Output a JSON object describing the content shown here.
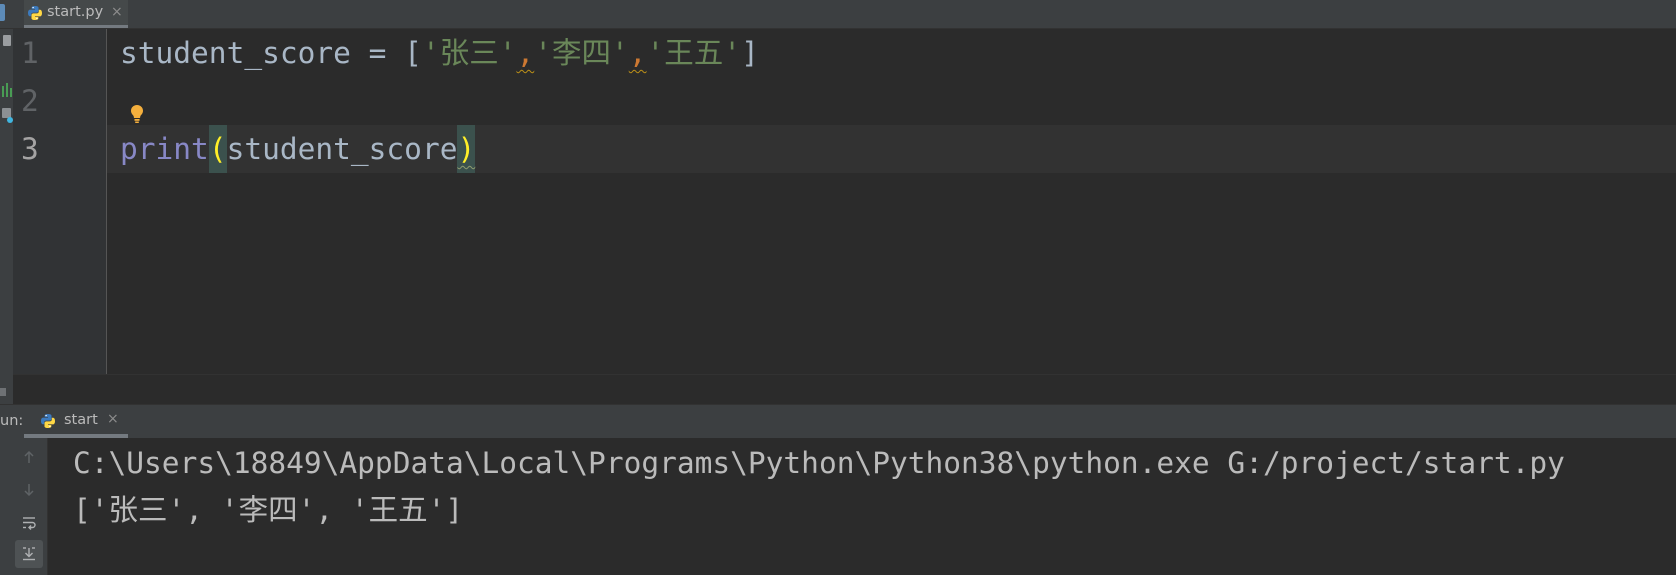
{
  "theme": {
    "editor-bg": "#2b2b2b",
    "panel-bg": "#3c3f41",
    "gutter-bg": "#313335",
    "text": "#a9b7c6",
    "string": "#6a8759",
    "builtin": "#8888c6",
    "comma": "#cc7832",
    "line-number": "#606366",
    "line-number-current": "#a4a3a3",
    "current-line": "#323232",
    "brace-bg": "#3b514d",
    "brace-fg": "#ffef28",
    "console-text": "#bbbbbb"
  },
  "editor_tabs": [
    {
      "label": "start.py",
      "icon": "python-file-icon",
      "close": "×"
    }
  ],
  "editor": {
    "current_line": 3,
    "intention_icon": "lightbulb-icon",
    "lines": [
      {
        "number": "1",
        "tokens": [
          "student_score = [",
          "'张三'",
          ",",
          "'李四'",
          ",",
          "'王五'",
          "]"
        ]
      },
      {
        "number": "2",
        "tokens": []
      },
      {
        "number": "3",
        "tokens": [
          "print",
          "(",
          "student_score",
          ")"
        ]
      }
    ]
  },
  "run_panel": {
    "label": "un:",
    "tabs": [
      {
        "label": "start",
        "icon": "python-icon",
        "close": "×"
      }
    ],
    "toolbar": [
      {
        "icon": "up-arrow-icon",
        "enabled": false,
        "toggled": false
      },
      {
        "icon": "down-arrow-icon",
        "enabled": false,
        "toggled": false
      },
      {
        "icon": "soft-wrap-icon",
        "enabled": true,
        "toggled": false
      },
      {
        "icon": "scroll-to-end-icon",
        "enabled": true,
        "toggled": true
      }
    ],
    "console": [
      "C:\\Users\\18849\\AppData\\Local\\Programs\\Python\\Python38\\python.exe G:/project/start.py",
      "['张三', '李四', '王五']"
    ]
  }
}
